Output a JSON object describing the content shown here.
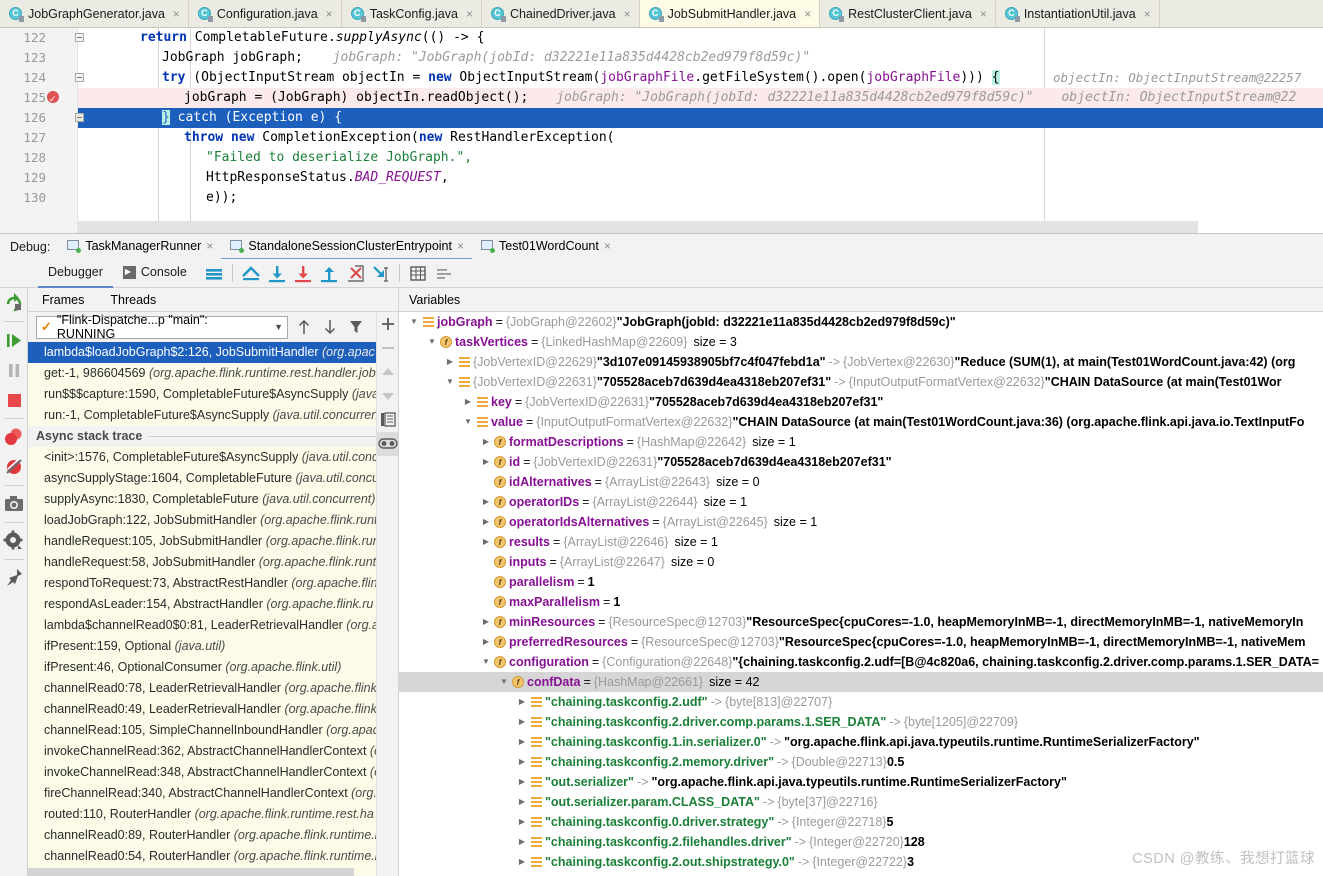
{
  "editor_tabs": [
    {
      "label": "JobGraphGenerator.java",
      "active": false,
      "icon": "java-class-icon"
    },
    {
      "label": "Configuration.java",
      "active": false,
      "icon": "java-class-icon"
    },
    {
      "label": "TaskConfig.java",
      "active": false,
      "icon": "java-class-icon"
    },
    {
      "label": "ChainedDriver.java",
      "active": false,
      "icon": "java-class-icon"
    },
    {
      "label": "JobSubmitHandler.java",
      "active": true,
      "icon": "java-class-icon"
    },
    {
      "label": "RestClusterClient.java",
      "active": false,
      "icon": "java-class-icon"
    },
    {
      "label": "InstantiationUtil.java",
      "active": false,
      "icon": "java-class-icon"
    }
  ],
  "editor": {
    "lines": [
      "122",
      "123",
      "124",
      "125",
      "126",
      "127",
      "128",
      "129",
      "130"
    ],
    "code": {
      "l122_kw": "return",
      "l122_rest": " CompletableFuture.",
      "l122_mth": "supplyAsync",
      "l122_tail": "(() -> {",
      "l123_text": "JobGraph jobGraph;",
      "l123_hint": "jobGraph: \"JobGraph(jobId: d32221e11a835d4428cb2ed979f8d59c)\"",
      "l124_kw": "try",
      "l124_a": " (ObjectInputStream objectIn = ",
      "l124_kw2": "new",
      "l124_b": " ObjectInputStream(",
      "l124_fld": "jobGraphFile",
      "l124_c": ".getFileSystem().open(",
      "l124_fld2": "jobGraphFile",
      "l124_d": "))) ",
      "l124_brace": "{",
      "l124_hint": "objectIn: ObjectInputStream@22257",
      "l125_text": "jobGraph = (JobGraph) objectIn.readObject();",
      "l125_hint1": "jobGraph: \"JobGraph(jobId: d32221e11a835d4428cb2ed979f8d59c)\"",
      "l125_hint2": "objectIn: ObjectInputStream@22",
      "l126_brace": "}",
      "l126_text": " catch (Exception e) {",
      "l127_kw": "throw",
      "l127_a": " ",
      "l127_kw2": "new",
      "l127_b": " CompletionException(",
      "l127_kw3": "new",
      "l127_c": " RestHandlerException(",
      "l128_str": "\"Failed to deserialize JobGraph.\",",
      "l129_a": "HttpResponseStatus.",
      "l129_stat": "BAD_REQUEST",
      "l129_b": ",",
      "l130_text": "e));"
    }
  },
  "debug_window": {
    "label": "Debug:",
    "tabs": [
      {
        "label": "TaskManagerRunner",
        "active": false
      },
      {
        "label": "StandaloneSessionClusterEntrypoint",
        "active": true
      },
      {
        "label": "Test01WordCount",
        "active": false
      }
    ]
  },
  "debugger_toolbar": {
    "tabs": [
      {
        "label": "Debugger",
        "active": true,
        "icon": "debugger-tab-icon"
      },
      {
        "label": "Console",
        "active": false,
        "icon": "console-icon"
      }
    ],
    "buttons": [
      {
        "name": "layout-settings-icon"
      },
      {
        "name": "show-execution-point-icon"
      },
      {
        "name": "step-over-icon"
      },
      {
        "name": "step-into-icon"
      },
      {
        "name": "step-out-icon"
      },
      {
        "name": "force-step-into-icon"
      },
      {
        "name": "run-to-cursor-icon"
      },
      {
        "name": "evaluate-expression-icon"
      },
      {
        "name": "mute-breakpoints-icon"
      }
    ]
  },
  "left_rail_buttons": [
    {
      "name": "rerun-icon",
      "title": "Rerun"
    },
    {
      "name": "resume-program-icon",
      "title": "Resume Program"
    },
    {
      "name": "pause-program-icon",
      "title": "Pause Program"
    },
    {
      "name": "stop-icon",
      "title": "Stop"
    },
    {
      "name": "view-breakpoints-icon",
      "title": "View Breakpoints"
    },
    {
      "name": "mute-breakpoints-icon",
      "title": "Mute Breakpoints"
    },
    {
      "name": "screenshot-icon",
      "title": "Screenshot"
    },
    {
      "name": "settings-gear-icon",
      "title": "Settings"
    },
    {
      "name": "pin-tab-icon",
      "title": "Pin Tab"
    }
  ],
  "frames": {
    "panel_tabs": [
      {
        "label": "Frames",
        "active": true
      },
      {
        "label": "Threads",
        "active": false
      }
    ],
    "thread_selector": {
      "value": "\"Flink-Dispatche...p \"main\": RUNNING",
      "status_icon": "check-mark-icon",
      "dropdown_icon": "chevron-down-icon"
    },
    "toolbar_icons": [
      "arrow-up-icon",
      "arrow-down-icon",
      "filter-icon"
    ],
    "right_rail_icons": [
      "plus-icon",
      "minus-icon",
      "move-up-icon",
      "move-down-icon",
      "copy-icon",
      "binoculars-icon"
    ],
    "stack": [
      {
        "method": "lambda$loadJobGraph$2:126, JobSubmitHandler",
        "pkg": "(org.apac",
        "selected": true
      },
      {
        "method": "get:-1, 986604569",
        "pkg": "(org.apache.flink.runtime.rest.handler.job.",
        "selected": false
      },
      {
        "method": "run$$$capture:1590, CompletableFuture$AsyncSupply",
        "pkg": "(java.",
        "selected": false
      },
      {
        "method": "run:-1, CompletableFuture$AsyncSupply",
        "pkg": "(java.util.concurrent",
        "selected": false
      }
    ],
    "async_header": "Async stack trace",
    "async_stack": [
      {
        "method": "<init>:1576, CompletableFuture$AsyncSupply",
        "pkg": "(java.util.concu"
      },
      {
        "method": "asyncSupplyStage:1604, CompletableFuture",
        "pkg": "(java.util.concur"
      },
      {
        "method": "supplyAsync:1830, CompletableFuture",
        "pkg": "(java.util.concurrent)"
      },
      {
        "method": "loadJobGraph:122, JobSubmitHandler",
        "pkg": "(org.apache.flink.runt"
      },
      {
        "method": "handleRequest:105, JobSubmitHandler",
        "pkg": "(org.apache.flink.run"
      },
      {
        "method": "handleRequest:58, JobSubmitHandler",
        "pkg": "(org.apache.flink.runti"
      },
      {
        "method": "respondToRequest:73, AbstractRestHandler",
        "pkg": "(org.apache.flin"
      },
      {
        "method": "respondAsLeader:154, AbstractHandler",
        "pkg": "(org.apache.flink.ru"
      },
      {
        "method": "lambda$channelRead0$0:81, LeaderRetrievalHandler",
        "pkg": "(org.a"
      },
      {
        "method": "ifPresent:159, Optional",
        "pkg": "(java.util)"
      },
      {
        "method": "ifPresent:46, OptionalConsumer",
        "pkg": "(org.apache.flink.util)"
      },
      {
        "method": "channelRead0:78, LeaderRetrievalHandler",
        "pkg": "(org.apache.flink."
      },
      {
        "method": "channelRead0:49, LeaderRetrievalHandler",
        "pkg": "(org.apache.flink."
      },
      {
        "method": "channelRead:105, SimpleChannelInboundHandler",
        "pkg": "(org.apac"
      },
      {
        "method": "invokeChannelRead:362, AbstractChannelHandlerContext",
        "pkg": "(o"
      },
      {
        "method": "invokeChannelRead:348, AbstractChannelHandlerContext",
        "pkg": "(o"
      },
      {
        "method": "fireChannelRead:340, AbstractChannelHandlerContext",
        "pkg": "(org.a"
      },
      {
        "method": "routed:110, RouterHandler",
        "pkg": "(org.apache.flink.runtime.rest.ha"
      },
      {
        "method": "channelRead0:89, RouterHandler",
        "pkg": "(org.apache.flink.runtime.r"
      },
      {
        "method": "channelRead0:54, RouterHandler",
        "pkg": "(org.apache.flink.runtime.r"
      }
    ]
  },
  "variables": {
    "header": "Variables",
    "rows": [
      {
        "indent": 0,
        "twisty": "open",
        "icon": "list-icon",
        "name": "jobGraph",
        "eq": true,
        "type": "{JobGraph@22602}",
        "value": "\"JobGraph(jobId: d32221e11a835d4428cb2ed979f8d59c)\"",
        "selected": false
      },
      {
        "indent": 1,
        "twisty": "open",
        "icon": "field-icon",
        "name": "taskVertices",
        "eq": true,
        "type": "{LinkedHashMap@22609}",
        "size": "size = 3",
        "selected": false
      },
      {
        "indent": 2,
        "twisty": "closed",
        "icon": "list-icon",
        "type": "{JobVertexID@22629}",
        "value": "\"3d107e09145938905bf7c4f047febd1a\"",
        "arrow": "->",
        "type2": "{JobVertex@22630}",
        "value2": "\"Reduce (SUM(1), at main(Test01WordCount.java:42) (org",
        "selected": false
      },
      {
        "indent": 2,
        "twisty": "open",
        "icon": "list-icon",
        "type": "{JobVertexID@22631}",
        "value": "\"705528aceb7d639d4ea4318eb207ef31\"",
        "arrow": "->",
        "type2": "{InputOutputFormatVertex@22632}",
        "value2": "\"CHAIN DataSource (at main(Test01Wor",
        "selected": false
      },
      {
        "indent": 3,
        "twisty": "closed",
        "icon": "list-icon",
        "name": "key",
        "eq": true,
        "type": "{JobVertexID@22631}",
        "value": "\"705528aceb7d639d4ea4318eb207ef31\"",
        "selected": false
      },
      {
        "indent": 3,
        "twisty": "open",
        "icon": "list-icon",
        "name": "value",
        "eq": true,
        "type": "{InputOutputFormatVertex@22632}",
        "value": "\"CHAIN DataSource (at main(Test01WordCount.java:36) (org.apache.flink.api.java.io.TextInputFo",
        "selected": false
      },
      {
        "indent": 4,
        "twisty": "closed",
        "icon": "field-icon",
        "name": "formatDescriptions",
        "eq": true,
        "type": "{HashMap@22642}",
        "size": "size = 1",
        "selected": false
      },
      {
        "indent": 4,
        "twisty": "closed",
        "icon": "field-icon",
        "name": "id",
        "eq": true,
        "type": "{JobVertexID@22631}",
        "value": "\"705528aceb7d639d4ea4318eb207ef31\"",
        "selected": false
      },
      {
        "indent": 4,
        "twisty": "none",
        "icon": "field-icon",
        "name": "idAlternatives",
        "eq": true,
        "type": "{ArrayList@22643}",
        "size": "size = 0",
        "selected": false
      },
      {
        "indent": 4,
        "twisty": "closed",
        "icon": "field-icon",
        "name": "operatorIDs",
        "eq": true,
        "type": "{ArrayList@22644}",
        "size": "size = 1",
        "selected": false
      },
      {
        "indent": 4,
        "twisty": "closed",
        "icon": "field-icon",
        "name": "operatorIdsAlternatives",
        "eq": true,
        "type": "{ArrayList@22645}",
        "size": "size = 1",
        "selected": false
      },
      {
        "indent": 4,
        "twisty": "closed",
        "icon": "field-icon",
        "name": "results",
        "eq": true,
        "type": "{ArrayList@22646}",
        "size": "size = 1",
        "selected": false
      },
      {
        "indent": 4,
        "twisty": "none",
        "icon": "field-icon",
        "name": "inputs",
        "eq": true,
        "type": "{ArrayList@22647}",
        "size": "size = 0",
        "selected": false
      },
      {
        "indent": 4,
        "twisty": "none",
        "icon": "field-icon",
        "name": "parallelism",
        "eq": true,
        "plain": "1",
        "selected": false
      },
      {
        "indent": 4,
        "twisty": "none",
        "icon": "field-icon",
        "name": "maxParallelism",
        "eq": true,
        "plain": "1",
        "selected": false
      },
      {
        "indent": 4,
        "twisty": "closed",
        "icon": "field-icon",
        "name": "minResources",
        "eq": true,
        "type": "{ResourceSpec@12703}",
        "value": "\"ResourceSpec{cpuCores=-1.0, heapMemoryInMB=-1, directMemoryInMB=-1, nativeMemoryIn",
        "selected": false
      },
      {
        "indent": 4,
        "twisty": "closed",
        "icon": "field-icon",
        "name": "preferredResources",
        "eq": true,
        "type": "{ResourceSpec@12703}",
        "value": "\"ResourceSpec{cpuCores=-1.0, heapMemoryInMB=-1, directMemoryInMB=-1, nativeMem",
        "selected": false
      },
      {
        "indent": 4,
        "twisty": "open",
        "icon": "field-icon",
        "name": "configuration",
        "eq": true,
        "type": "{Configuration@22648}",
        "value": "\"{chaining.taskconfig.2.udf=[B@4c820a6, chaining.taskconfig.2.driver.comp.params.1.SER_DATA=",
        "selected": false
      },
      {
        "indent": 5,
        "twisty": "open",
        "icon": "field-icon",
        "name": "confData",
        "eq": true,
        "type": "{HashMap@22661}",
        "size": "size = 42",
        "selected": true
      },
      {
        "indent": 6,
        "twisty": "closed",
        "icon": "list-icon",
        "strname": "\"chaining.taskconfig.2.udf\"",
        "arrow": "->",
        "type2": "{byte[813]@22707}",
        "selected": false
      },
      {
        "indent": 6,
        "twisty": "closed",
        "icon": "list-icon",
        "strname": "\"chaining.taskconfig.2.driver.comp.params.1.SER_DATA\"",
        "arrow": "->",
        "type2": "{byte[1205]@22709}",
        "selected": false
      },
      {
        "indent": 6,
        "twisty": "closed",
        "icon": "list-icon",
        "strname": "\"chaining.taskconfig.1.in.serializer.0\"",
        "arrow": "->",
        "value2": "\"org.apache.flink.api.java.typeutils.runtime.RuntimeSerializerFactory\"",
        "selected": false
      },
      {
        "indent": 6,
        "twisty": "closed",
        "icon": "list-icon",
        "strname": "\"chaining.taskconfig.2.memory.driver\"",
        "arrow": "->",
        "type2": "{Double@22713}",
        "plain2": "0.5",
        "selected": false
      },
      {
        "indent": 6,
        "twisty": "closed",
        "icon": "list-icon",
        "strname": "\"out.serializer\"",
        "arrow": "->",
        "value2": "\"org.apache.flink.api.java.typeutils.runtime.RuntimeSerializerFactory\"",
        "selected": false
      },
      {
        "indent": 6,
        "twisty": "closed",
        "icon": "list-icon",
        "strname": "\"out.serializer.param.CLASS_DATA\"",
        "arrow": "->",
        "type2": "{byte[37]@22716}",
        "selected": false
      },
      {
        "indent": 6,
        "twisty": "closed",
        "icon": "list-icon",
        "strname": "\"chaining.taskconfig.0.driver.strategy\"",
        "arrow": "->",
        "type2": "{Integer@22718}",
        "plain2": "5",
        "selected": false
      },
      {
        "indent": 6,
        "twisty": "closed",
        "icon": "list-icon",
        "strname": "\"chaining.taskconfig.2.filehandles.driver\"",
        "arrow": "->",
        "type2": "{Integer@22720}",
        "plain2": "128",
        "selected": false
      },
      {
        "indent": 6,
        "twisty": "closed",
        "icon": "list-icon",
        "strname": "\"chaining.taskconfig.2.out.shipstrategy.0\"",
        "arrow": "->",
        "type2": "{Integer@22722}",
        "plain2": "3",
        "selected": false
      }
    ]
  },
  "watermark": "CSDN @教练、我想打篮球",
  "colors": {
    "selection_blue": "#1c5fbd",
    "tab_active_bg": "#fdfbe6",
    "frames_bg": "#fbfbe8",
    "breakpoint_red": "#e05252",
    "accent_teal": "#56c6d6"
  }
}
